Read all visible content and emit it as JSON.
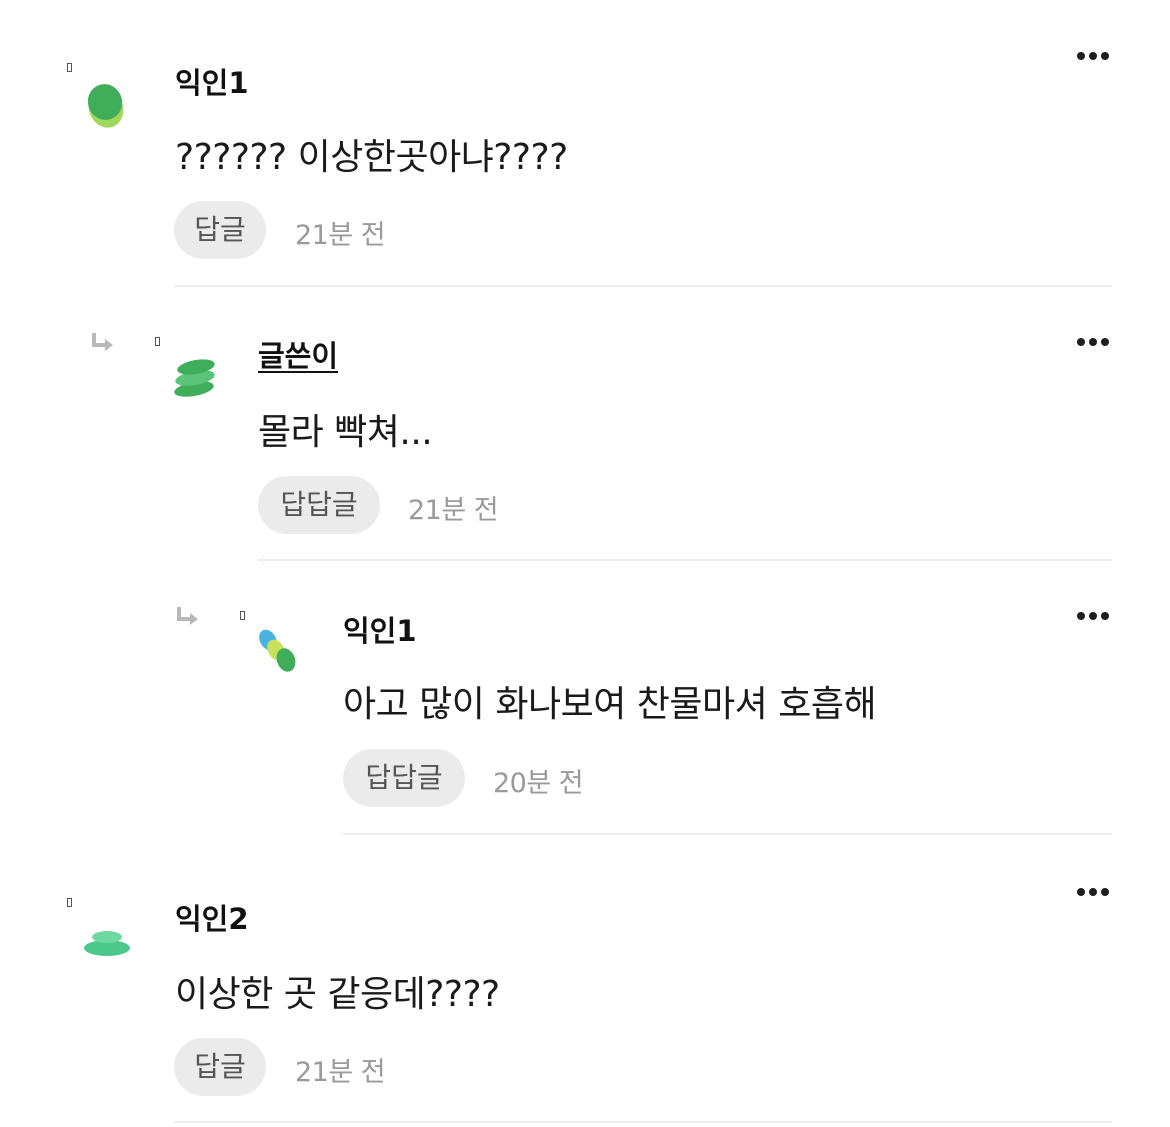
{
  "comments": [
    {
      "author": "익인1",
      "text": "?????? 이상한곳아냐????",
      "reply_label": "답글",
      "time": "21분 전"
    },
    {
      "author": "글쓴이",
      "text": "몰라 빡쳐...",
      "reply_label": "답답글",
      "time": "21분 전"
    },
    {
      "author": "익인1",
      "text": "아고 많이 화나보여 찬물마셔 호흡해",
      "reply_label": "답답글",
      "time": "20분 전"
    },
    {
      "author": "익인2",
      "text": "이상한 곳 같응데????",
      "reply_label": "답글",
      "time": "21분 전"
    }
  ],
  "icons": {
    "more": "more-horizontal-icon",
    "reply_arrow": "reply-arrow-icon",
    "marker": "unknown-glyph-icon"
  },
  "colors": {
    "button_bg": "#ebebeb",
    "time_text": "#9a9a9a",
    "divider": "#ededed",
    "avatar_green": "#3fae5a",
    "avatar_light_green": "#9fd85a",
    "avatar_mint": "#4cc98a",
    "avatar_blue": "#4bb3e0"
  }
}
